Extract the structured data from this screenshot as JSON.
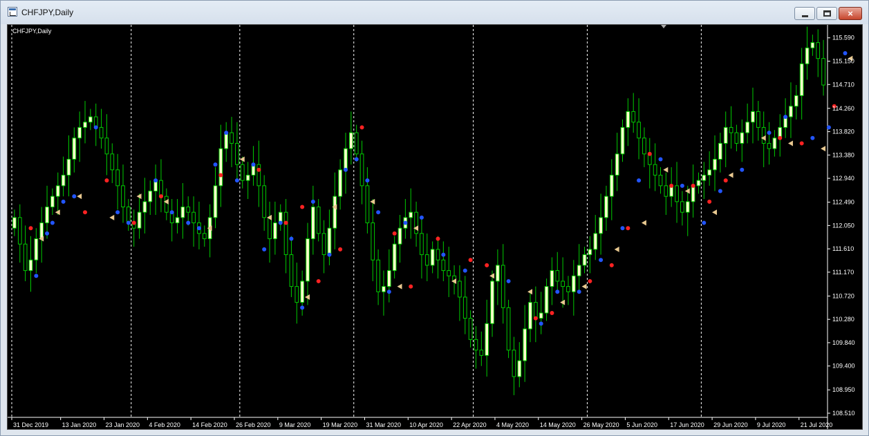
{
  "window": {
    "title": "CHFJPY,Daily",
    "buttons": {
      "minimize": "minimize-icon",
      "maximize": "maximize-icon",
      "close": "×"
    }
  },
  "chart_label": "CHFJPY,Daily",
  "colors": {
    "background": "#000000",
    "bull_body": "#ffffcc",
    "bear_body": "#000000",
    "wick": "#00cc00",
    "axis_text": "#ffffff",
    "grid": "#ffffff",
    "marker_blue": "#2255ff",
    "marker_red": "#ff2222",
    "marker_tan": "#e8c890"
  },
  "chart_data": {
    "type": "candlestick",
    "symbol": "CHFJPY",
    "timeframe": "Daily",
    "x_labels": [
      "31 Dec 2019",
      "13 Jan 2020",
      "23 Jan 2020",
      "4 Feb 2020",
      "14 Feb 2020",
      "26 Feb 2020",
      "9 Mar 2020",
      "19 Mar 2020",
      "31 Mar 2020",
      "10 Apr 2020",
      "22 Apr 2020",
      "4 May 2020",
      "14 May 2020",
      "26 May 2020",
      "5 Jun 2020",
      "17 Jun 2020",
      "29 Jun 2020",
      "9 Jul 2020",
      "21 Jul 2020"
    ],
    "x_label_index": [
      0,
      9,
      17,
      25,
      33,
      41,
      49,
      57,
      65,
      73,
      81,
      89,
      97,
      105,
      113,
      121,
      129,
      137,
      145
    ],
    "separator_index": [
      0,
      22,
      42,
      63,
      85,
      106,
      127
    ],
    "y_ticks": [
      115.59,
      115.15,
      114.71,
      114.26,
      113.82,
      113.38,
      112.94,
      112.49,
      112.05,
      111.61,
      111.17,
      110.72,
      110.28,
      109.84,
      109.4,
      108.95,
      108.51
    ],
    "ylim": [
      108.51,
      115.73
    ],
    "closes": [
      112.2,
      111.7,
      111.2,
      111.4,
      111.8,
      112.1,
      112.4,
      112.6,
      112.8,
      113.0,
      113.3,
      113.7,
      113.9,
      114.0,
      114.1,
      113.9,
      113.7,
      113.4,
      113.1,
      112.8,
      112.4,
      112.1,
      112.0,
      112.3,
      112.5,
      112.7,
      112.9,
      112.6,
      112.3,
      112.1,
      112.2,
      112.4,
      112.3,
      112.1,
      111.9,
      111.8,
      112.2,
      112.8,
      113.5,
      113.8,
      113.6,
      113.2,
      112.9,
      113.0,
      113.2,
      112.8,
      112.2,
      111.8,
      112.1,
      112.3,
      111.5,
      110.9,
      110.6,
      111.0,
      111.8,
      112.4,
      111.9,
      111.5,
      112.0,
      112.6,
      113.1,
      113.5,
      113.8,
      113.4,
      112.8,
      112.1,
      111.4,
      110.8,
      110.9,
      111.2,
      111.7,
      112.0,
      112.2,
      112.3,
      111.9,
      111.5,
      111.3,
      111.6,
      111.4,
      111.2,
      111.1,
      111.0,
      110.7,
      110.3,
      109.9,
      109.7,
      109.6,
      110.2,
      111.0,
      111.3,
      110.5,
      109.7,
      109.2,
      109.5,
      110.1,
      110.6,
      110.3,
      110.4,
      110.9,
      111.2,
      111.0,
      110.9,
      110.8,
      111.1,
      111.3,
      111.5,
      111.6,
      111.9,
      112.2,
      112.6,
      113.0,
      113.4,
      113.9,
      114.2,
      114.0,
      113.7,
      113.4,
      113.2,
      113.0,
      112.8,
      112.6,
      112.8,
      112.5,
      112.3,
      112.5,
      112.8,
      112.9,
      113.0,
      113.1,
      113.3,
      113.6,
      113.9,
      113.8,
      113.6,
      113.8,
      114.0,
      114.2,
      113.9,
      113.6,
      113.5,
      113.7,
      113.9,
      114.1,
      114.3,
      114.5,
      115.1,
      115.4,
      115.5,
      115.2,
      114.7
    ],
    "markers": {
      "blue": [
        [
          4,
          111.1
        ],
        [
          6,
          111.9
        ],
        [
          7,
          112.1
        ],
        [
          9,
          112.5
        ],
        [
          11,
          112.6
        ],
        [
          15,
          113.9
        ],
        [
          19,
          112.3
        ],
        [
          21,
          112.1
        ],
        [
          26,
          112.9
        ],
        [
          29,
          112.3
        ],
        [
          32,
          112.1
        ],
        [
          34,
          112.0
        ],
        [
          37,
          113.2
        ],
        [
          39,
          113.8
        ],
        [
          41,
          112.9
        ],
        [
          44,
          113.2
        ],
        [
          46,
          111.6
        ],
        [
          49,
          112.1
        ],
        [
          51,
          111.8
        ],
        [
          53,
          110.5
        ],
        [
          55,
          112.5
        ],
        [
          58,
          111.5
        ],
        [
          61,
          113.1
        ],
        [
          63,
          113.3
        ],
        [
          65,
          112.9
        ],
        [
          67,
          112.3
        ],
        [
          69,
          110.8
        ],
        [
          72,
          112.1
        ],
        [
          75,
          112.2
        ],
        [
          79,
          111.5
        ],
        [
          83,
          111.2
        ],
        [
          91,
          111.0
        ],
        [
          97,
          110.2
        ],
        [
          100,
          110.8
        ],
        [
          104,
          110.8
        ],
        [
          108,
          111.4
        ],
        [
          112,
          112.0
        ],
        [
          115,
          112.9
        ],
        [
          119,
          113.3
        ],
        [
          123,
          112.8
        ],
        [
          127,
          112.1
        ],
        [
          130,
          112.7
        ],
        [
          134,
          113.1
        ],
        [
          139,
          113.8
        ],
        [
          142,
          114.1
        ],
        [
          147,
          113.7
        ],
        [
          150,
          113.9
        ],
        [
          153,
          115.3
        ]
      ],
      "red": [
        [
          3,
          112.0
        ],
        [
          13,
          112.3
        ],
        [
          17,
          112.9
        ],
        [
          22,
          112.1
        ],
        [
          27,
          112.6
        ],
        [
          38,
          113.0
        ],
        [
          45,
          113.1
        ],
        [
          50,
          112.1
        ],
        [
          53,
          112.4
        ],
        [
          56,
          111.0
        ],
        [
          60,
          111.6
        ],
        [
          64,
          113.9
        ],
        [
          70,
          111.9
        ],
        [
          73,
          110.9
        ],
        [
          78,
          111.8
        ],
        [
          84,
          111.4
        ],
        [
          87,
          111.3
        ],
        [
          96,
          110.3
        ],
        [
          99,
          110.4
        ],
        [
          106,
          111.0
        ],
        [
          110,
          111.3
        ],
        [
          113,
          112.0
        ],
        [
          117,
          113.4
        ],
        [
          121,
          112.8
        ],
        [
          125,
          112.8
        ],
        [
          128,
          112.5
        ],
        [
          131,
          112.9
        ],
        [
          141,
          113.7
        ],
        [
          145,
          113.6
        ],
        [
          151,
          114.3
        ]
      ],
      "tan": [
        [
          5,
          111.8
        ],
        [
          8,
          112.3
        ],
        [
          12,
          112.6
        ],
        [
          18,
          112.2
        ],
        [
          23,
          112.6
        ],
        [
          28,
          112.5
        ],
        [
          36,
          112.0
        ],
        [
          42,
          113.3
        ],
        [
          47,
          112.2
        ],
        [
          54,
          110.7
        ],
        [
          59,
          112.4
        ],
        [
          66,
          112.5
        ],
        [
          71,
          110.9
        ],
        [
          74,
          112.0
        ],
        [
          81,
          111.0
        ],
        [
          88,
          111.1
        ],
        [
          95,
          110.8
        ],
        [
          101,
          110.6
        ],
        [
          105,
          110.9
        ],
        [
          111,
          111.6
        ],
        [
          116,
          112.1
        ],
        [
          120,
          113.1
        ],
        [
          124,
          112.7
        ],
        [
          129,
          112.3
        ],
        [
          132,
          113.0
        ],
        [
          138,
          113.7
        ],
        [
          143,
          113.6
        ],
        [
          149,
          113.5
        ],
        [
          154,
          115.2
        ]
      ]
    }
  }
}
